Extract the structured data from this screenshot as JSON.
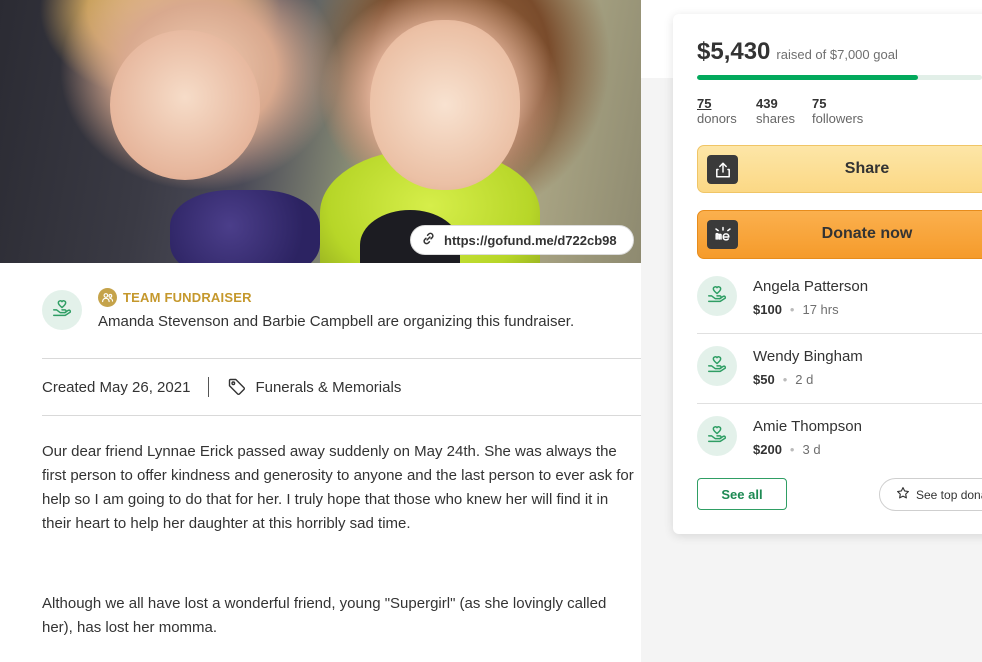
{
  "hero": {
    "short_link": "https://gofund.me/d722cb98",
    "photo_alt": "photo"
  },
  "organizer": {
    "team_label": "TEAM FUNDRAISER",
    "description": "Amanda Stevenson and Barbie Campbell are organizing this fundraiser."
  },
  "meta": {
    "created": "Created May 26, 2021",
    "category": "Funerals & Memorials"
  },
  "story": [
    "Our dear friend Lynnae Erick passed away suddenly on May 24th. She was always the first person to offer kindness and generosity to anyone and the last person to ever ask for help so I am going to do that for her. I truly hope that those who knew her will find it in their heart to help her daughter at this horribly sad time.",
    "Although we all have lost a wonderful friend, young \"Supergirl\" (as she lovingly called her), has lost her momma."
  ],
  "campaign": {
    "raised": "$5,430",
    "goal_text": "raised of $7,000 goal",
    "progress_fraction": 0.7757,
    "stats": [
      {
        "num": "75",
        "label": "donors"
      },
      {
        "num": "439",
        "label": "shares"
      },
      {
        "num": "75",
        "label": "followers"
      }
    ],
    "share_label": "Share",
    "donate_label": "Donate now",
    "donations": [
      {
        "name": "Angela Patterson",
        "amount": "$100",
        "time": "17 hrs"
      },
      {
        "name": "Wendy Bingham",
        "amount": "$50",
        "time": "2 d"
      },
      {
        "name": "Amie Thompson",
        "amount": "$200",
        "time": "3 d"
      }
    ],
    "see_all_label": "See all",
    "see_top_label": "See top donations"
  },
  "colors": {
    "brand_green": "#02a95c",
    "team_gold": "#c5982c",
    "share_yellow": "#fbd885",
    "donate_orange": "#f59b2b"
  }
}
